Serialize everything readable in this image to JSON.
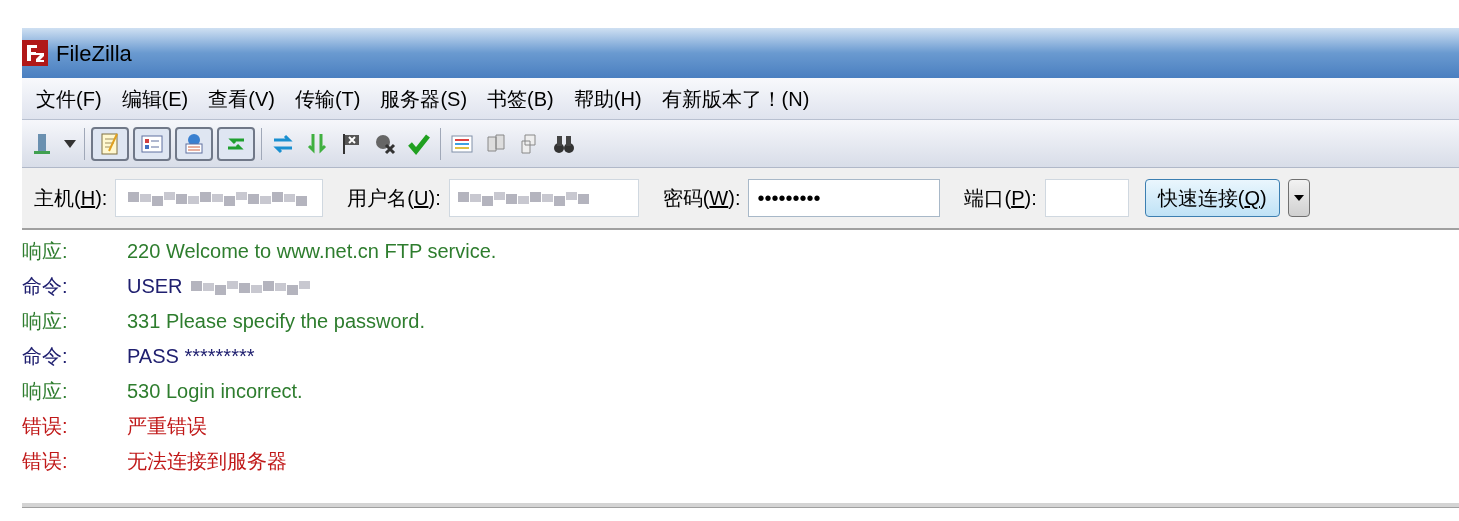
{
  "window": {
    "title": "FileZilla"
  },
  "menu": [
    "文件(F)",
    "编辑(E)",
    "查看(V)",
    "传输(T)",
    "服务器(S)",
    "书签(B)",
    "帮助(H)",
    "有新版本了！(N)"
  ],
  "toolbar": {
    "toggles": [
      {
        "selected": true
      },
      {
        "selected": true
      },
      {
        "selected": true
      },
      {
        "selected": true
      }
    ]
  },
  "quickconnect": {
    "host": {
      "before": "主机(",
      "mnemonic": "H",
      "after": "):",
      "redacted": true
    },
    "user": {
      "before": "用户名(",
      "mnemonic": "U",
      "after": "):",
      "redacted": true
    },
    "password": {
      "before": "密码(",
      "mnemonic": "W",
      "after": "):",
      "value": "•••••••••"
    },
    "port": {
      "before": "端口(",
      "mnemonic": "P",
      "after": "):"
    },
    "button": {
      "before": "快速连接(",
      "mnemonic": "Q",
      "after": ")"
    }
  },
  "log": [
    {
      "kind": "response",
      "label": "响应:",
      "text": "220 Welcome to www.net.cn FTP service."
    },
    {
      "kind": "command",
      "label": "命令:",
      "text": "USER",
      "redacted": true
    },
    {
      "kind": "response",
      "label": "响应:",
      "text": "331 Please specify the password."
    },
    {
      "kind": "command",
      "label": "命令:",
      "text": "PASS *********"
    },
    {
      "kind": "response",
      "label": "响应:",
      "text": "530 Login incorrect."
    },
    {
      "kind": "error",
      "label": "错误:",
      "text": "严重错误"
    },
    {
      "kind": "error",
      "label": "错误:",
      "text": "无法连接到服务器"
    }
  ]
}
